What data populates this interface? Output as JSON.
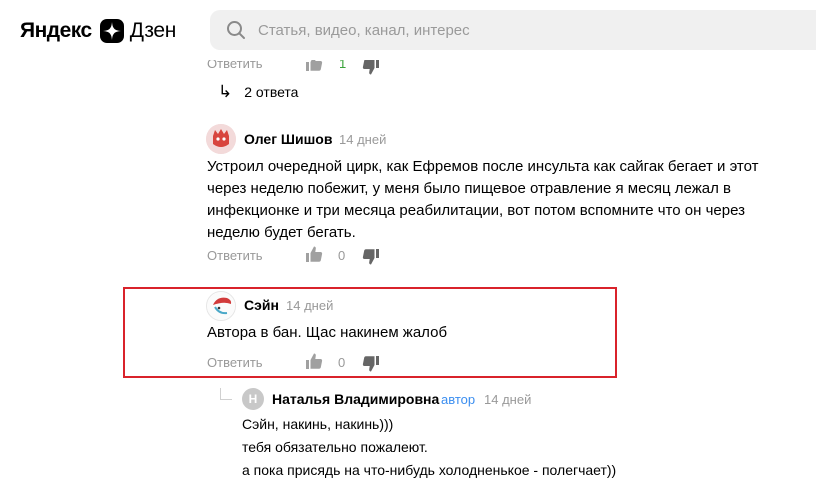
{
  "header": {
    "logo_yandex": "Яндекс",
    "logo_zen": "Дзен",
    "search_placeholder": "Статья, видео, канал, интерес",
    "search_value": ""
  },
  "top_partial": {
    "reply_label": "Ответить",
    "like_count": "1"
  },
  "replies_toggle": {
    "arrow": "↳",
    "label": "2 ответа"
  },
  "comments": [
    {
      "author": "Олег Шишов",
      "time": "14 дней",
      "lines": [
        "Устроил очередной цирк, как Ефремов после инсульта как сайгак бегает и этот",
        "через неделю побежит, у меня было пищевое отравление я месяц лежал в",
        "инфекционке и три месяца реабилитации, вот потом вспомните что он через",
        "неделю будет бегать."
      ],
      "reply_label": "Ответить",
      "likes": "0"
    },
    {
      "author": "Сэйн",
      "time": "14 дней",
      "lines": [
        "Автора в бан. Щас накинем жалоб"
      ],
      "reply_label": "Ответить",
      "likes": "0"
    }
  ],
  "nested_reply": {
    "avatar_letter": "Н",
    "author": "Наталья Владимировна",
    "badge": "автор",
    "time": "14 дней",
    "lines": [
      "Сэйн, накинь, накинь)))",
      "тебя обязательно пожалеют.",
      "а пока присядь на что-нибудь холодненькое - полегчает))"
    ]
  },
  "colors": {
    "highlight": "#d9232b",
    "muted": "#999999",
    "author_badge": "#3b8ef0",
    "like_green": "#3aa33a"
  },
  "icons": [
    "search-icon",
    "zen-logo-icon",
    "thumbs-up-icon",
    "thumbs-down-icon",
    "reply-arrow-icon"
  ]
}
